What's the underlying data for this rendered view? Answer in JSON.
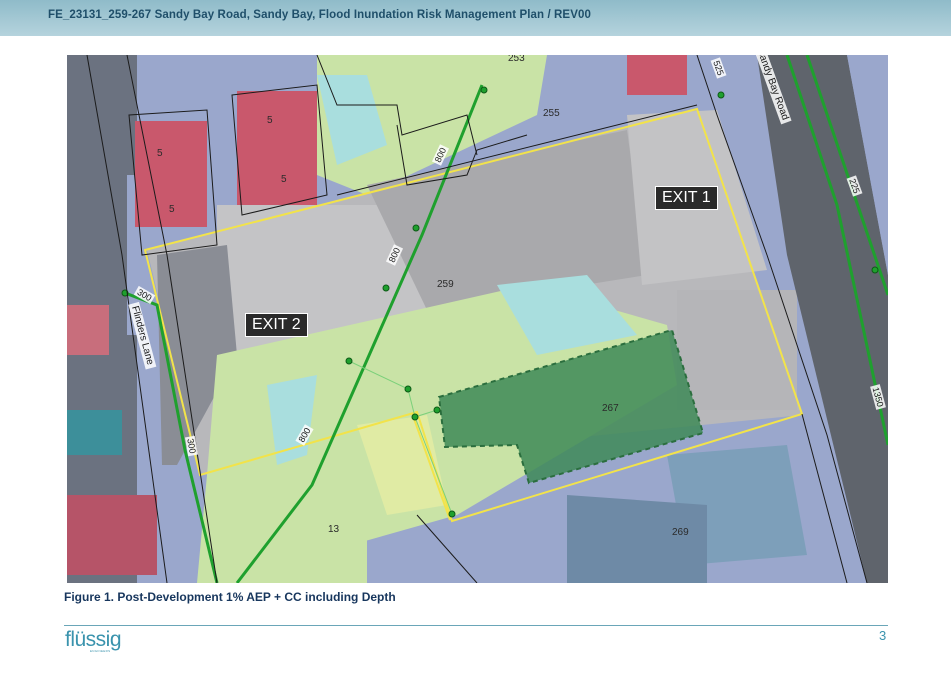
{
  "header": {
    "title": "FE_23131_259-267 Sandy Bay Road, Sandy Bay, Flood Inundation Risk Management Plan / REV00"
  },
  "map": {
    "exits": [
      "EXIT 1",
      "EXIT 2"
    ],
    "lot_numbers": {
      "lot_253": "253",
      "lot_255": "255",
      "lot_259": "259",
      "lot_267": "267",
      "lot_269": "269",
      "lot_13": "13",
      "lot_5a": "5",
      "lot_5b": "5",
      "lot_5c": "5",
      "lot_5d": "5"
    },
    "pipe_labels": {
      "p800a": "800",
      "p800b": "800",
      "p800c": "800",
      "p300a": "300",
      "p300b": "300",
      "p525": "525",
      "p225": "225",
      "p1350": "1350"
    },
    "road_labels": {
      "sandy_bay_road": "Sandy Bay Road",
      "flinders_lane": "Flinders Lane"
    },
    "colors": {
      "flood_shallow": "#c9e3a6",
      "flood_medium": "#a9dede",
      "flood_deep": "#9aa7cc",
      "site_boundary": "#f2e34a",
      "pipe_network": "#1fa02e",
      "proposed_building": "#3e8a57"
    }
  },
  "caption": "Figure 1. Post-Development 1% AEP + CC including Depth",
  "footer": {
    "logo": "flüssig",
    "logo_sub": "ENGINEERS",
    "page_number": "3"
  }
}
